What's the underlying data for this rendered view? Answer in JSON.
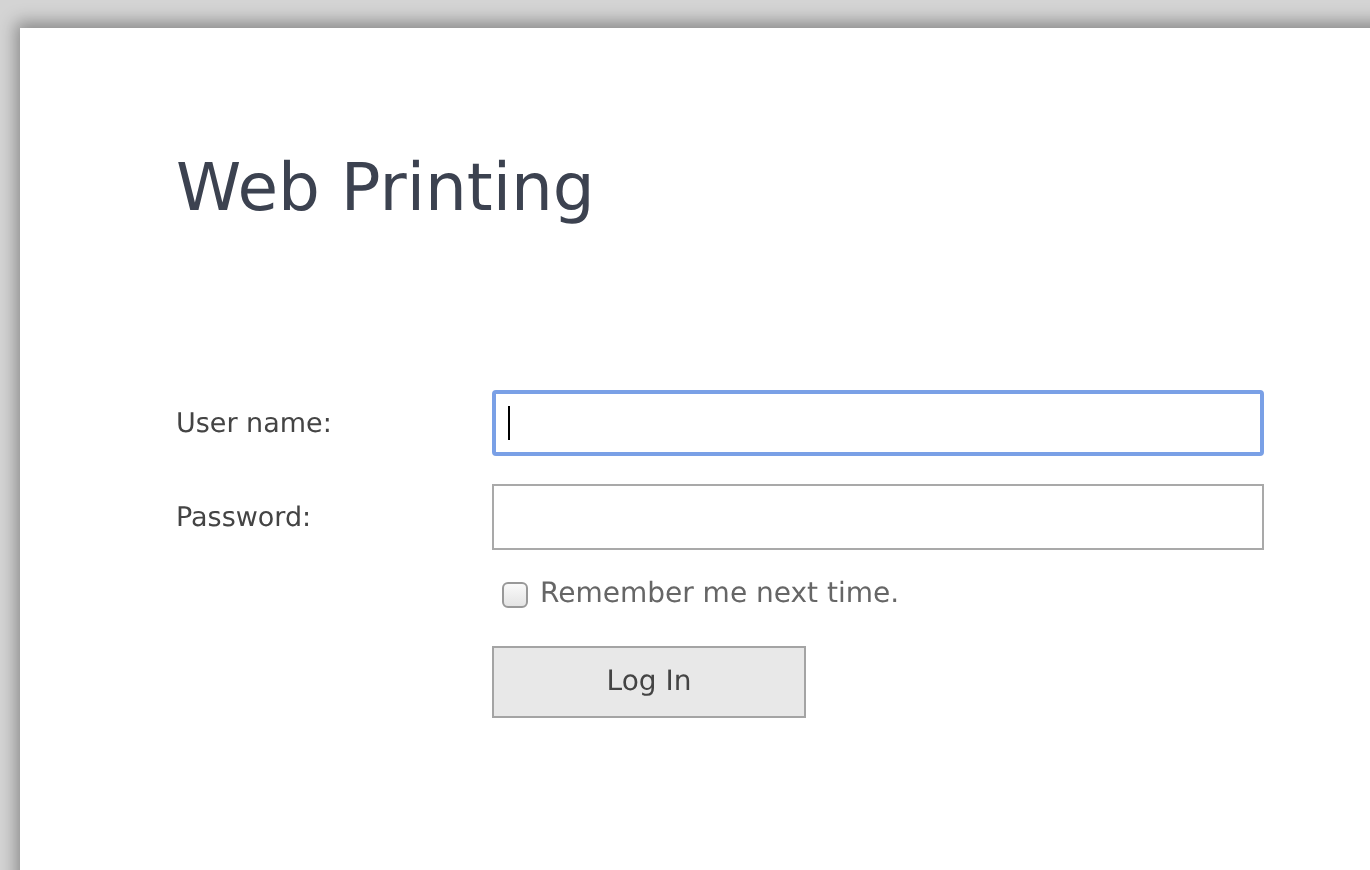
{
  "title": "Web Printing",
  "fields": [
    {
      "label": "User name:",
      "focused": true
    },
    {
      "label": "Password:",
      "focused": false
    }
  ],
  "remember": {
    "label": "Remember me next time.",
    "checked": false
  },
  "button": "Log In"
}
